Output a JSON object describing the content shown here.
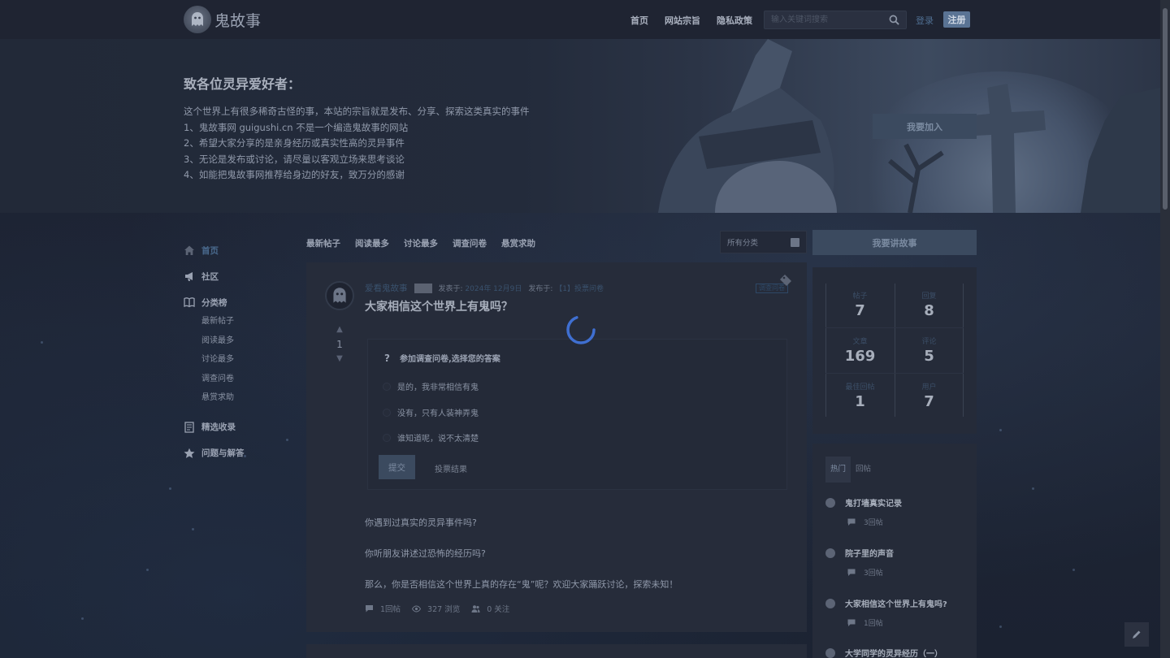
{
  "site": {
    "name": "鬼故事"
  },
  "topnav": {
    "items": [
      "首页",
      "网站宗旨",
      "隐私政策"
    ]
  },
  "search": {
    "placeholder": "输入关键词搜索"
  },
  "auth": {
    "login": "登录",
    "register": "注册"
  },
  "hero": {
    "title": "致各位灵异爱好者：",
    "lines": [
      "这个世界上有很多稀奇古怪的事，本站的宗旨就是发布、分享、探索这类真实的事件",
      "1、鬼故事网 guigushi.cn 不是一个编造鬼故事的网站",
      "2、希望大家分享的是亲身经历或真实性高的灵异事件",
      "3、无论是发布或讨论，请尽量以客观立场来思考谈论",
      "4、如能把鬼故事网推荐给身边的好友，致万分的感谢"
    ],
    "join_button": "我要加入"
  },
  "leftnav": {
    "home": "首页",
    "community": "社区",
    "ranking": "分类榜",
    "ranking_subs": [
      "最新帖子",
      "阅读最多",
      "讨论最多",
      "调查问卷",
      "悬赏求助"
    ],
    "featured": "精选收录",
    "qa": "问题与解答"
  },
  "tabs": [
    "最新帖子",
    "阅读最多",
    "讨论最多",
    "调查问卷",
    "悬赏求助"
  ],
  "category_select": {
    "value": "所有分类"
  },
  "post_story_button": "我要讲故事",
  "post": {
    "author": "爱看鬼故事",
    "published_label": "发表于:",
    "published_date": "2024年 12月9日",
    "in_label": "发布于:",
    "in_category": "【1】投票问卷",
    "tag": "调查问卷",
    "title": "大家相信这个世界上有鬼吗？",
    "votes": "1",
    "poll": {
      "icon": "?",
      "heading": "参加调查问卷,选择您的答案",
      "options": [
        "是的，我非常相信有鬼",
        "没有，只有人装神弄鬼",
        "谁知道呢，说不太清楚"
      ],
      "submit": "提交",
      "results": "投票结果"
    },
    "body": [
      "你遇到过真实的灵异事件吗?",
      "你听朋友讲述过恐怖的经历吗?",
      "那么，你是否相信这个世界上真的存在“鬼”呢？欢迎大家踊跃讨论，探索未知！"
    ],
    "stats": {
      "replies": "1回帖",
      "views": "327 浏览",
      "follows": "0 关注"
    }
  },
  "site_stats": [
    {
      "label": "帖子",
      "value": "7"
    },
    {
      "label": "回复",
      "value": "8"
    },
    {
      "label": "文章",
      "value": "169"
    },
    {
      "label": "评论",
      "value": "5"
    },
    {
      "label": "最佳回帖",
      "value": "1"
    },
    {
      "label": "用户",
      "value": "7"
    }
  ],
  "hot": {
    "tabs": [
      "热门",
      "回帖"
    ],
    "items": [
      {
        "title": "鬼打墙真实记录",
        "replies": "3回帖"
      },
      {
        "title": "院子里的声音",
        "replies": "3回帖"
      },
      {
        "title": "大家相信这个世界上有鬼吗?",
        "replies": "1回帖"
      },
      {
        "title": "大学同学的灵异经历（一）",
        "replies": ""
      }
    ]
  },
  "colors": {
    "accent": "#3b4a5f",
    "link": "#3a526e",
    "spinner": "#3f6fd1"
  }
}
